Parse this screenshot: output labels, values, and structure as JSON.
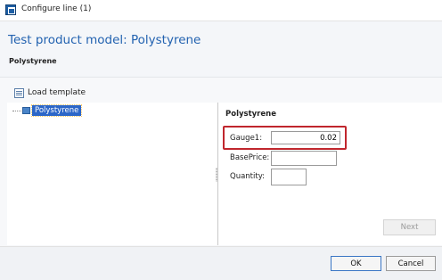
{
  "window": {
    "title": "Configure line (1)"
  },
  "header": {
    "title": "Test product model: Polystyrene",
    "subtitle": "Polystyrene"
  },
  "toolbar": {
    "load_template_label": "Load template"
  },
  "tree": {
    "items": [
      {
        "label": "Polystyrene",
        "selected": true
      }
    ]
  },
  "details": {
    "title": "Polystyrene",
    "fields": {
      "gauge": {
        "label": "Gauge1:",
        "value": "0.02",
        "highlighted": true
      },
      "base_price": {
        "label": "BasePrice:",
        "value": ""
      },
      "quantity": {
        "label": "Quantity:",
        "value": ""
      }
    },
    "next_label": "Next"
  },
  "footer": {
    "ok_label": "OK",
    "cancel_label": "Cancel"
  },
  "colors": {
    "accent": "#2262b0",
    "selection": "#2b66c8",
    "highlight_border": "#c0262d"
  }
}
